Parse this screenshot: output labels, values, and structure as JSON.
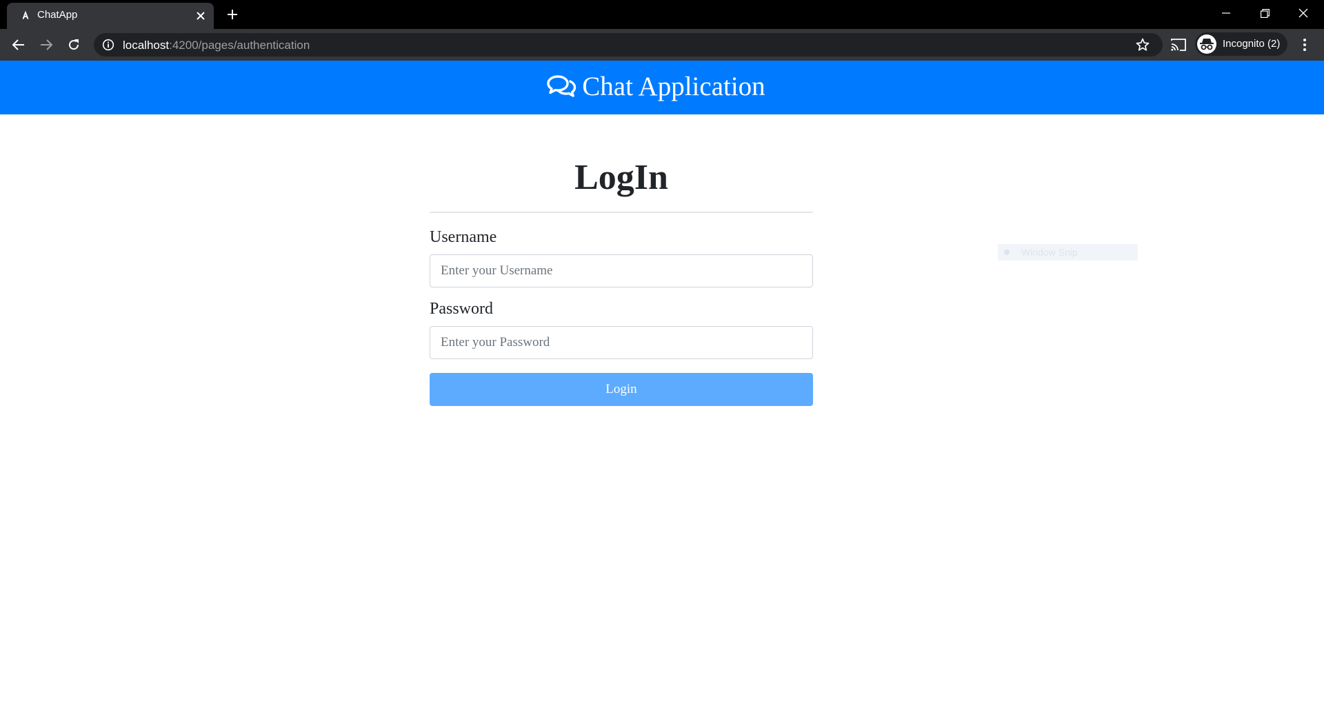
{
  "browser": {
    "tab": {
      "title": "ChatApp",
      "favicon": "angular-logo-icon"
    },
    "address_bar": {
      "host": "localhost",
      "path": ":4200/pages/authentication"
    },
    "profile_label": "Incognito (2)"
  },
  "app": {
    "title": "Chat Application",
    "title_icon": "comments-icon",
    "brand_color": "#007bff"
  },
  "login_form": {
    "heading": "LogIn",
    "username": {
      "label": "Username",
      "placeholder": "Enter your Username",
      "value": ""
    },
    "password": {
      "label": "Password",
      "placeholder": "Enter your Password",
      "value": ""
    },
    "submit_label": "Login",
    "submit_color": "#5cabff"
  },
  "overlay": {
    "window_snip_label": "Window Snip"
  }
}
